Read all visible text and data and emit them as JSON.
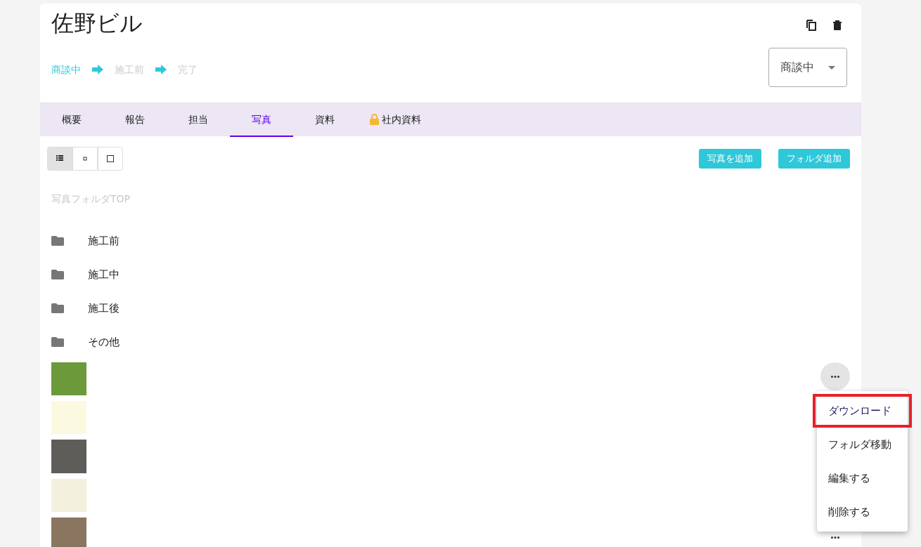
{
  "title": "佐野ビル",
  "steps": [
    {
      "label": "商談中",
      "selected": true
    },
    {
      "label": "施工前",
      "selected": false
    },
    {
      "label": "完了",
      "selected": false
    }
  ],
  "status_select": {
    "value": "商談中"
  },
  "tabs": [
    {
      "label": "概要",
      "selected": false,
      "locked": false
    },
    {
      "label": "報告",
      "selected": false,
      "locked": false
    },
    {
      "label": "担当",
      "selected": false,
      "locked": false
    },
    {
      "label": "写真",
      "selected": true,
      "locked": false
    },
    {
      "label": "資料",
      "selected": false,
      "locked": false
    },
    {
      "label": "社内資料",
      "selected": false,
      "locked": true
    }
  ],
  "view_toggle": [
    {
      "kind": "list",
      "selected": true
    },
    {
      "kind": "small",
      "selected": false
    },
    {
      "kind": "large",
      "selected": false
    }
  ],
  "buttons": [
    "写真を追加",
    "フォルダ追加"
  ],
  "breadcrumb": "写真フォルダTOP",
  "folders": [
    "施工前",
    "施工中",
    "施工後",
    "その他"
  ],
  "photos": [
    {
      "kind": "forest"
    },
    {
      "kind": "document"
    },
    {
      "kind": "night"
    },
    {
      "kind": "calendar"
    },
    {
      "kind": "people"
    }
  ],
  "context_menu": [
    {
      "label": "ダウンロード",
      "highlighted": true
    },
    {
      "label": "フォルダ移動",
      "highlighted": false
    },
    {
      "label": "編集する",
      "highlighted": false
    },
    {
      "label": "削除する",
      "highlighted": false
    }
  ]
}
